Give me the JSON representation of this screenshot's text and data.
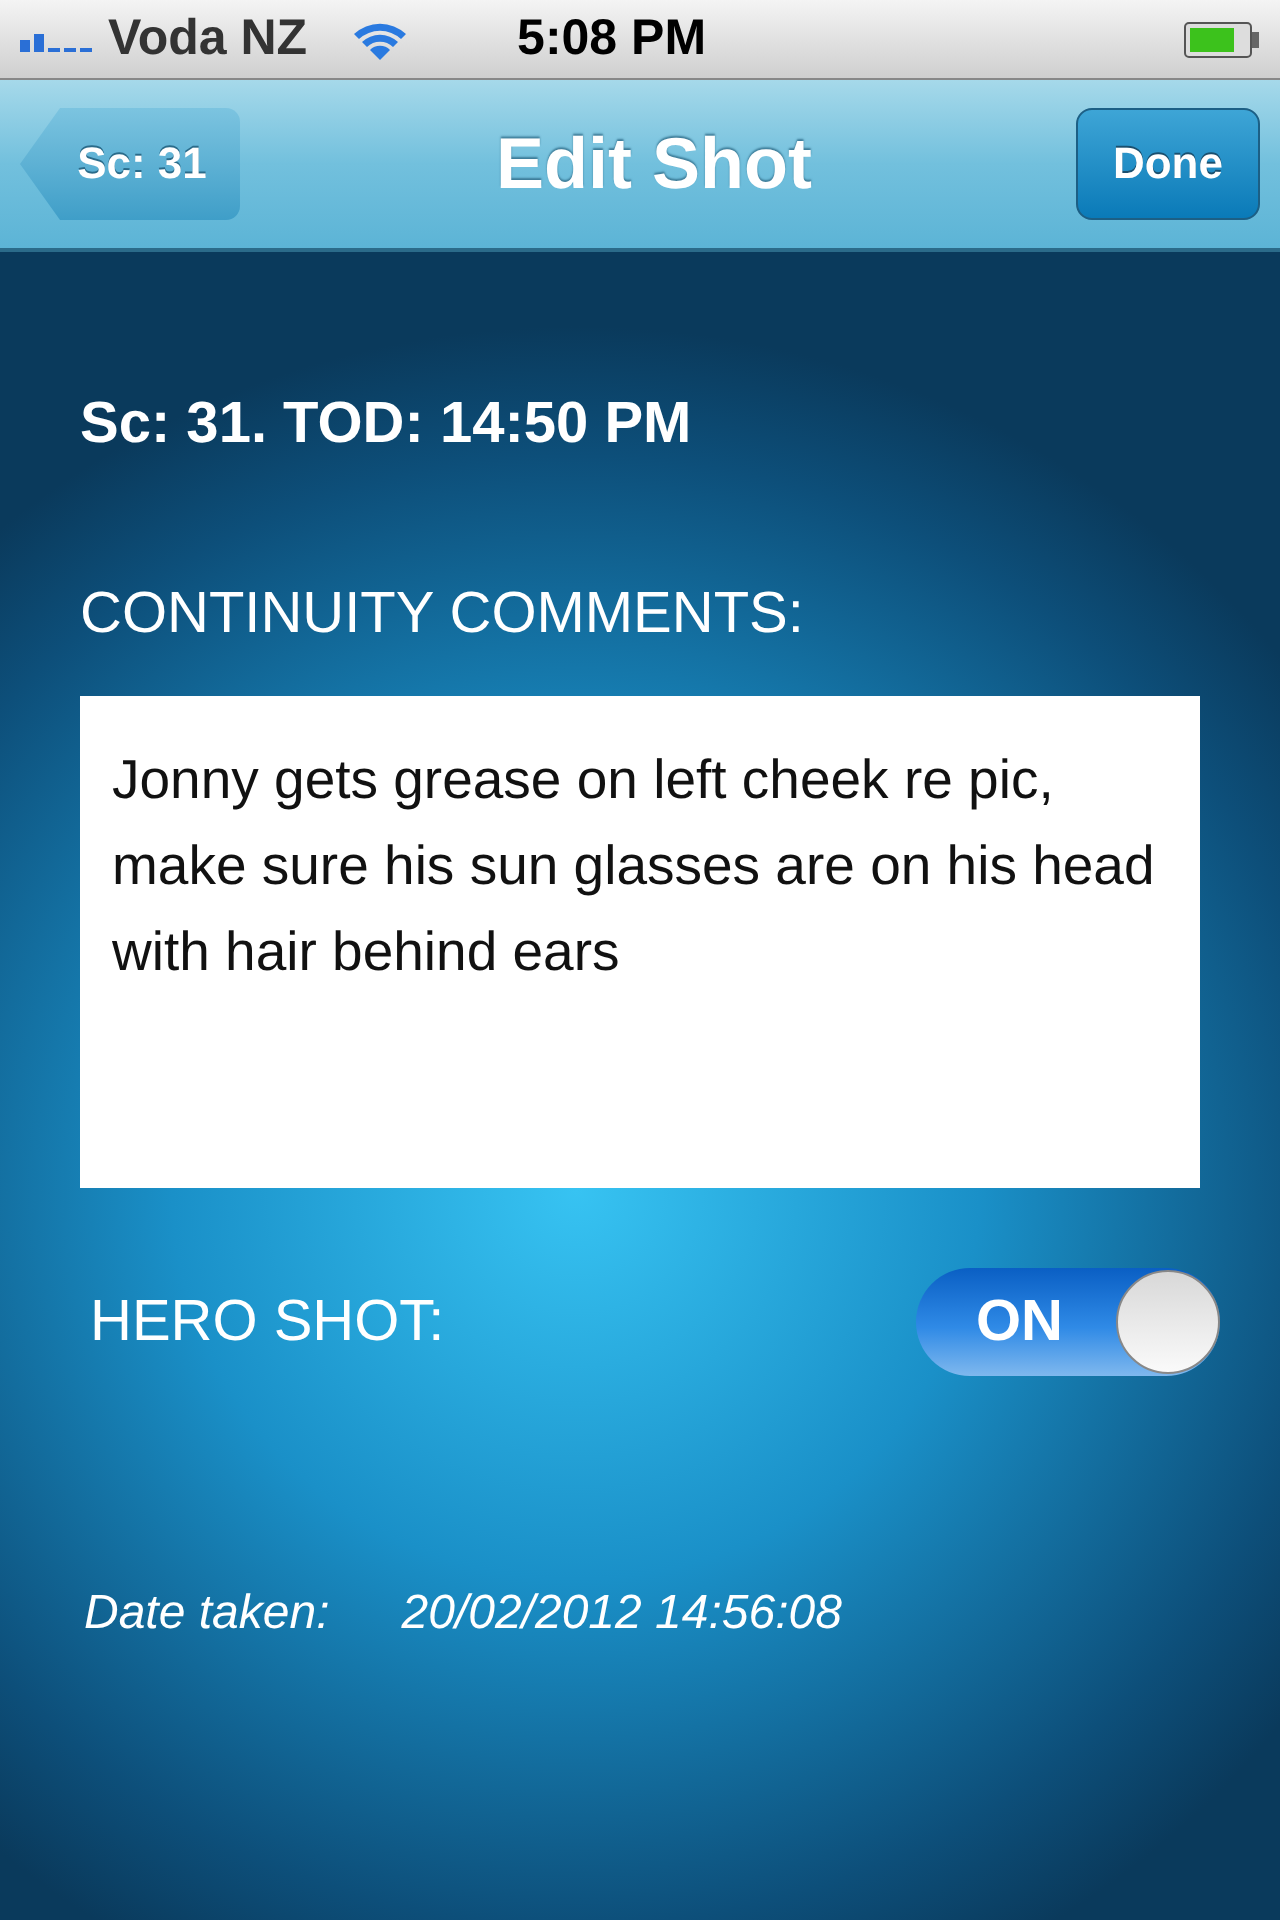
{
  "status_bar": {
    "carrier": "Voda NZ",
    "time": "5:08 PM"
  },
  "nav_bar": {
    "back_button": "Sc: 31",
    "title": "Edit Shot",
    "done_button": "Done"
  },
  "scene_heading": "Sc: 31. TOD: 14:50 PM",
  "comments": {
    "label": "CONTINUITY COMMENTS:",
    "value": "Jonny gets grease on left cheek re pic, make sure his sun glasses are on his head with hair behind ears"
  },
  "hero_shot": {
    "label": "HERO SHOT:",
    "on": true,
    "state_text": "ON"
  },
  "date_taken": {
    "label": "Date taken:",
    "value": "20/02/2012 14:56:08"
  }
}
